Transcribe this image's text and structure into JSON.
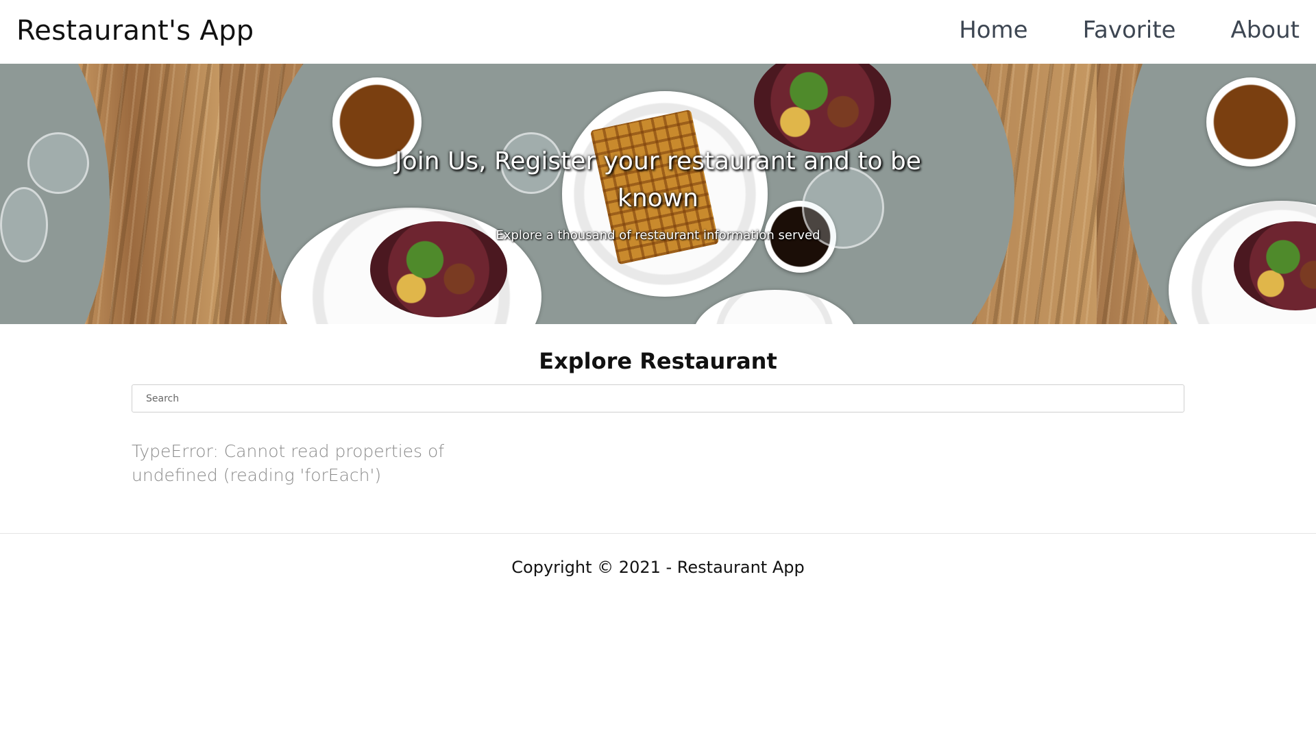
{
  "header": {
    "brand": "Restaurant's App",
    "nav": [
      {
        "label": "Home"
      },
      {
        "label": "Favorite"
      },
      {
        "label": "About"
      }
    ]
  },
  "hero": {
    "title": "Join Us, Register your restaurant and to be known",
    "subtitle": "Explore a thousand of restaurant information served"
  },
  "main": {
    "section_title": "Explore Restaurant",
    "search": {
      "placeholder": "Search",
      "value": ""
    },
    "error_message": "TypeError: Cannot read properties of undefined (reading 'forEach')"
  },
  "footer": {
    "copyright": "Copyright © 2021 - Restaurant App"
  },
  "colors": {
    "nav_text": "#3d4652",
    "error_text": "#8a8a8a"
  }
}
